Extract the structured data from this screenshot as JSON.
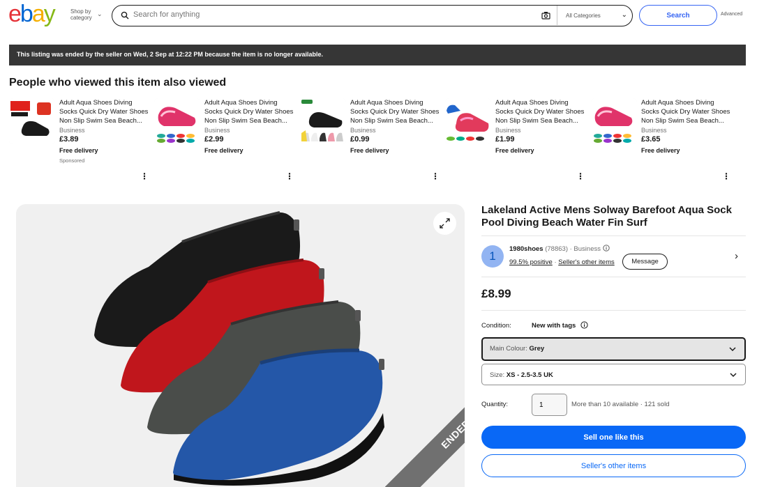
{
  "header": {
    "logo": [
      "e",
      "b",
      "a",
      "y"
    ],
    "shop_by_category": "Shop by category",
    "search_placeholder": "Search for anything",
    "category_select": "All Categories",
    "search_button": "Search",
    "advanced": "Advanced"
  },
  "banner": {
    "text": "This listing was ended by the seller on Wed, 2 Sep at 12:22 PM because the item is no longer available."
  },
  "also_viewed": {
    "title": "People who viewed this item also viewed",
    "items": [
      {
        "name": "Adult Aqua Shoes Diving Socks Quick Dry Water Shoes Non Slip Swim Sea Beach...",
        "seller_type": "Business",
        "price": "£3.89",
        "delivery": "Free delivery",
        "sponsored": "Sponsored"
      },
      {
        "name": "Adult Aqua Shoes Diving Socks Quick Dry Water Shoes Non Slip Swim Sea Beach...",
        "seller_type": "Business",
        "price": "£2.99",
        "delivery": "Free delivery",
        "sponsored": ""
      },
      {
        "name": "Adult Aqua Shoes Diving Socks Quick Dry Water Shoes Non Slip Swim Sea Beach...",
        "seller_type": "Business",
        "price": "£0.99",
        "delivery": "Free delivery",
        "sponsored": ""
      },
      {
        "name": "Adult Aqua Shoes Diving Socks Quick Dry Water Shoes Non Slip Swim Sea Beach...",
        "seller_type": "Business",
        "price": "£1.99",
        "delivery": "Free delivery",
        "sponsored": ""
      },
      {
        "name": "Adult Aqua Shoes Diving Socks Quick Dry Water Shoes Non Slip Swim Sea Beach...",
        "seller_type": "Business",
        "price": "£3.65",
        "delivery": "Free delivery",
        "sponsored": ""
      }
    ]
  },
  "main_image": {
    "ribbon": "ENDED",
    "shoe_colors": [
      "#1a1a1a",
      "#c0161c",
      "#4a4d4a",
      "#2457a8"
    ]
  },
  "item": {
    "title": "Lakeland Active Mens Solway Barefoot Aqua Sock Pool Diving Beach Water Fin Surf",
    "seller": {
      "avatar_letter": "1",
      "name": "1980shoes",
      "feedback_count": "(78863)",
      "type": "· Business",
      "positive": "99.5% positive",
      "other_items": "Seller's other items",
      "message": "Message"
    },
    "price": "£8.99",
    "condition_label": "Condition:",
    "condition_value": "New with tags",
    "colour_label": "Main Colour:",
    "colour_value": "Grey",
    "size_label": "Size:",
    "size_value": "XS - 2.5-3.5 UK",
    "quantity_label": "Quantity:",
    "quantity_value": "1",
    "availability": "More than 10 available · 121 sold",
    "primary_button": "Sell one like this",
    "secondary_button": "Seller's other items"
  },
  "colors": {
    "accent_blue": "#0968f6",
    "banner_bg": "#363636"
  }
}
